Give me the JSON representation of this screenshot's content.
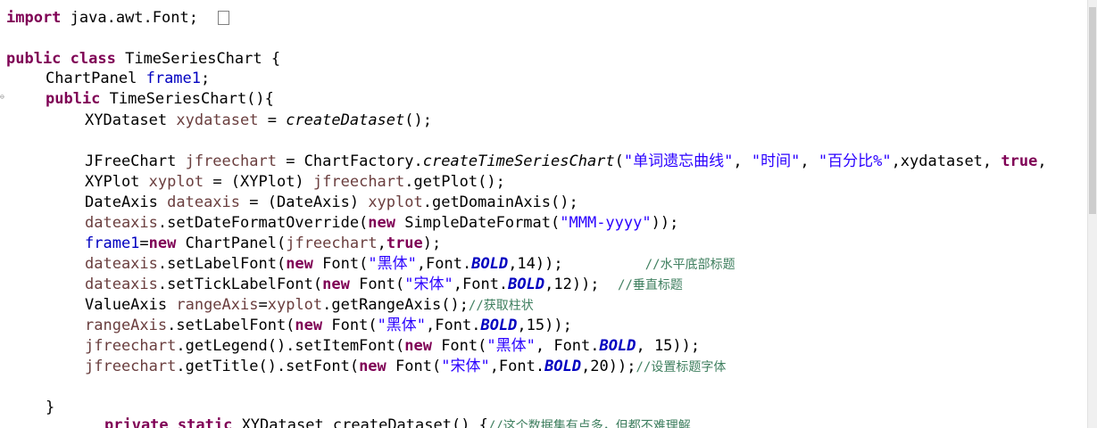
{
  "code": {
    "l1": {
      "kw": "import",
      "rest": " java.awt.Font;  "
    },
    "l2": {
      "kw1": "public",
      "kw2": "class",
      "rest": " TimeSeriesChart {"
    },
    "l3": {
      "type": "ChartPanel ",
      "fld": "frame1",
      "end": ";"
    },
    "l4": {
      "kw": "public",
      "rest": " TimeSeriesChart(){"
    },
    "l5": {
      "type": "XYDataset ",
      "var": "xydataset",
      "mid": " = ",
      "call": "createDataset",
      "end": "();"
    },
    "l6": {
      "type": "JFreeChart ",
      "var": "jfreechart",
      "mid": " = ChartFactory.",
      "call": "createTimeSeriesChart",
      "p1": "(",
      "s1": "\"单词遗忘曲线\"",
      "c1": ", ",
      "s2": "\"时间\"",
      "c2": ", ",
      "s3": "\"百分比%\"",
      "c3": ",xydataset, ",
      "kw": "true",
      "end": ","
    },
    "l7": {
      "type": "XYPlot ",
      "var": "xyplot",
      "mid": " = (XYPlot) ",
      "var2": "jfreechart",
      "end": ".getPlot();"
    },
    "l8": {
      "type": "DateAxis ",
      "var": "dateaxis",
      "mid": " = (DateAxis) ",
      "var2": "xyplot",
      "end": ".getDomainAxis();"
    },
    "l9": {
      "var": "dateaxis",
      "mid": ".setDateFormatOverride(",
      "kw": "new",
      "mid2": " SimpleDateFormat(",
      "str": "\"MMM-yyyy\"",
      "end": "));"
    },
    "l10": {
      "fld": "frame1",
      "mid": "=",
      "kw": "new",
      "mid2": " ChartPanel(",
      "var": "jfreechart",
      "c": ",",
      "kw2": "true",
      "end": ");"
    },
    "l11": {
      "var": "dateaxis",
      "mid": ".setLabelFont(",
      "kw": "new",
      "mid2": " Font(",
      "str": "\"黑体\"",
      "mid3": ",Font.",
      "const": "BOLD",
      "end": ",14));",
      "pad": "         ",
      "cmt": "//水平底部标题"
    },
    "l12": {
      "var": "dateaxis",
      "mid": ".setTickLabelFont(",
      "kw": "new",
      "mid2": " Font(",
      "str": "\"宋体\"",
      "mid3": ",Font.",
      "const": "BOLD",
      "end": ",12));",
      "pad": "  ",
      "cmt": "//垂直标题"
    },
    "l13": {
      "type": "ValueAxis ",
      "var": "rangeAxis",
      "mid": "=",
      "var2": "xyplot",
      "end": ".getRangeAxis();",
      "cmt": "//获取柱状"
    },
    "l14": {
      "var": "rangeAxis",
      "mid": ".setLabelFont(",
      "kw": "new",
      "mid2": " Font(",
      "str": "\"黑体\"",
      "mid3": ",Font.",
      "const": "BOLD",
      "end": ",15));"
    },
    "l15": {
      "var": "jfreechart",
      "mid": ".getLegend().setItemFont(",
      "kw": "new",
      "mid2": " Font(",
      "str": "\"黑体\"",
      "mid3": ", Font.",
      "const": "BOLD",
      "end": ", 15));"
    },
    "l16": {
      "var": "jfreechart",
      "mid": ".getTitle().setFont(",
      "kw": "new",
      "mid2": " Font(",
      "str": "\"宋体\"",
      "mid3": ",Font.",
      "const": "BOLD",
      "end": ",20));",
      "cmt": "//设置标题字体"
    },
    "l17": {
      "text": "}"
    },
    "l18": {
      "kw1": "private",
      "kw2": "static",
      "rest": " XYDataset createDataset() {",
      "cmt": "//这个数据集有点多，但都不难理解"
    }
  }
}
